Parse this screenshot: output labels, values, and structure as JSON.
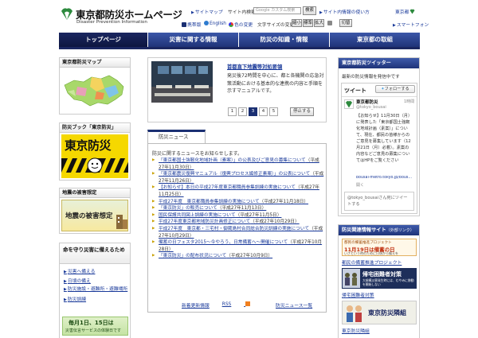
{
  "header": {
    "title": "東京都防災ホームページ",
    "subtitle": "Disaster Prevention Information",
    "links": {
      "sitemap": "サイトマップ",
      "site_search_label": "サイト内検索",
      "search_placeholder": "Google カスタム検索",
      "search_button": "検索",
      "site_usage": "サイト内情報の使い方",
      "tokyo": "東京都",
      "cellphone": "携帯版",
      "english": "English",
      "color_change": "色の変更",
      "font_size_label": "文字サイズの変更",
      "size_small": "縮小",
      "size_normal": "標準",
      "size_large": "拡大",
      "switch": "切替",
      "smartphone": "スマートフォン"
    }
  },
  "nav": {
    "items": [
      {
        "label": "トップページ"
      },
      {
        "label": "災害に関する情報"
      },
      {
        "label": "防災の知識・情報"
      },
      {
        "label": "東京都の取組"
      }
    ]
  },
  "left": {
    "map_title": "東京都防災マップ",
    "book_title": "防災ブック「東京防災」",
    "book_banner": "東京防災",
    "quake_title": "地震の被害想定",
    "quake_banner": "地震の被害想定",
    "protect_title": "命を守り災害に備えるため",
    "protect_items": [
      "災害へ備える",
      "日頃の備え",
      "防災施設・避難所・避難場所",
      "防災訓練"
    ],
    "bottom_banner_line1": "毎月1日、15日は",
    "bottom_banner_line2": "災害伝言サービスの体験日です"
  },
  "feature": {
    "title": "首都直下地震等対処要領",
    "desc": "発災後72時間を中心に、都と各機関の応急対策活動における基本的な連携の内容と手順を示すマニュアルです。",
    "pages": [
      "1",
      "2",
      "3",
      "4",
      "5"
    ],
    "active_page": "3",
    "pause": "停止する"
  },
  "news": {
    "tab": "防災ニュース",
    "intro": "防災に関するニュースをお知らせします。",
    "items": [
      {
        "text": "「東京都国土強靭化地域計画（素案）」の公表及びご意見の募集について",
        "date": "（平成27年11月30日）"
      },
      {
        "text": "「東京都震災復興マニュアル（復興プロセス編修正素案）」の公表について",
        "date": "（平成27年11月26日）"
      },
      {
        "text": "【お知らせ】本日の平成27年度東京都職員参集訓練の実施について",
        "date": "（平成27年11月25日）"
      },
      {
        "text": "平成27年度　東京都職員参集訓練の実施について",
        "date": "（平成27年11月18日）"
      },
      {
        "text": "「東京防災」の販売について",
        "date": "（平成27年11月13日）"
      },
      {
        "text": "国民保護共同図上訓練の実施について",
        "date": "（平成27年11月5日）"
      },
      {
        "text": "平成27年度東京都地域防災計画修正について",
        "date": "（平成27年10月29日）"
      },
      {
        "text": "平成27年度　東京都・三宅村・御蔵島村合同総合防災訓練の実施について",
        "date": "（平成27年10月29日）"
      },
      {
        "text": "備蓄の日フェスタ2015～今やろう、日常備蓄へ～開催について",
        "date": "（平成27年10月28日）"
      },
      {
        "text": "「東京防災」の配布状況について",
        "date": "（平成27年10月9日）"
      }
    ],
    "footer": [
      "新着更新情報",
      "RSS",
      "防災ニュース一覧"
    ]
  },
  "twitter": {
    "title": "東京都防災ツイッター",
    "desc": "最新の防災情報を発信中です",
    "tweet_label": "ツイート",
    "follow": "フォローする",
    "account": "東京都防災",
    "handle": "@tokyo_bousai",
    "time": "1時間",
    "body": "【お知らせ】11月30日（月）に発表した「東京都国土強靭化地域計画（素案）」について、現在、都民の皆様からのご意見を募集しています（12月21日（月）必着）。素案の内容などご意見の募集についてはHPをご覧ください",
    "link": "bousai-metro.tokyo.jp/bous...",
    "more": "開く",
    "reply": "@tokyo_bousaiさん宛にツイートする"
  },
  "related": {
    "title": "防災関連情報サイト",
    "title_sub": "（外部リンク）",
    "banner1_title": "都民の備蓄推進プロジェクト",
    "banner1_line": "11月19日は備蓄の日",
    "banner1_sub": "いざという時のために日頃から備えを",
    "link1": "都民の備蓄推進プロジェクト",
    "banner2_title": "帰宅困難者対策",
    "banner2_sub": "大規模災害発生時には、むやみに移動を開始しない",
    "link2": "帰宅困難者対策",
    "banner3_title": "東京防災隣組",
    "link3": "東京防災隣組"
  },
  "colors": {
    "nav_blue": "#1f3378",
    "nav_active": "#0d1640",
    "link_blue": "#1a3a9a",
    "book_yellow": "#f5d800"
  }
}
